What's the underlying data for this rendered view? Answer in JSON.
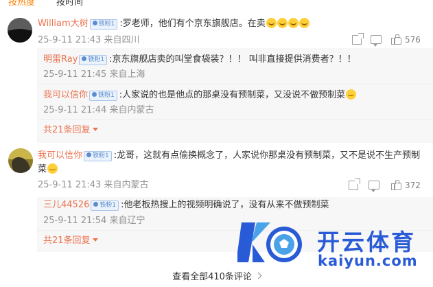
{
  "sort_tabs": {
    "hot": "按热度",
    "time": "按时间"
  },
  "comments": [
    {
      "user": "William大树",
      "badge": "铁粉1",
      "text": ":罗老师，他们有个京东旗舰店。在卖",
      "emoji_count": 4,
      "meta": "25-9-11 21:43 来自四川",
      "likes": "576",
      "replies": [
        {
          "user": "明雷Ray",
          "badge": "铁粉1",
          "text": ":京东旗舰店卖的叫堂食袋装？！！ 叫非直接提供消费者？！！",
          "meta": "25-9-11 21:45 来自上海"
        },
        {
          "user": "我可以信你",
          "badge": "铁粉1",
          "text": ":人家说的也是他点的那桌没有预制菜，又没说不做预制菜",
          "meta": "25-9-11 21:44 来自内蒙古"
        }
      ],
      "more_replies": "共21条回复"
    },
    {
      "user": "我可以信你",
      "badge": "铁粉1",
      "text_line1": ":龙哥，这就有点偷换概念了，人家说你那桌没有预制菜，又不是说不生产预制",
      "text_line2": "菜",
      "meta": "25-9-11 21:43 来自内蒙古",
      "likes": "372",
      "replies": [
        {
          "user": "三儿44526",
          "badge": "铁粉1",
          "text": ":他老板热搜上的视频明确说了，没有从来不做预制菜",
          "meta": "25-9-11 21:54 来自辽宁"
        }
      ],
      "more_replies": "共21条回复"
    }
  ],
  "view_all": "查看全部410条评论",
  "watermark": {
    "cn": "开云体育",
    "url": "kaiyun.com"
  },
  "icons": [
    "share-icon",
    "comment-icon",
    "like-icon",
    "chevron-right-icon",
    "chevron-down-icon"
  ],
  "colors": {
    "accent": "#eb7350",
    "watermark": "#2a5bd7",
    "reply_bg": "#f7f7f7"
  }
}
